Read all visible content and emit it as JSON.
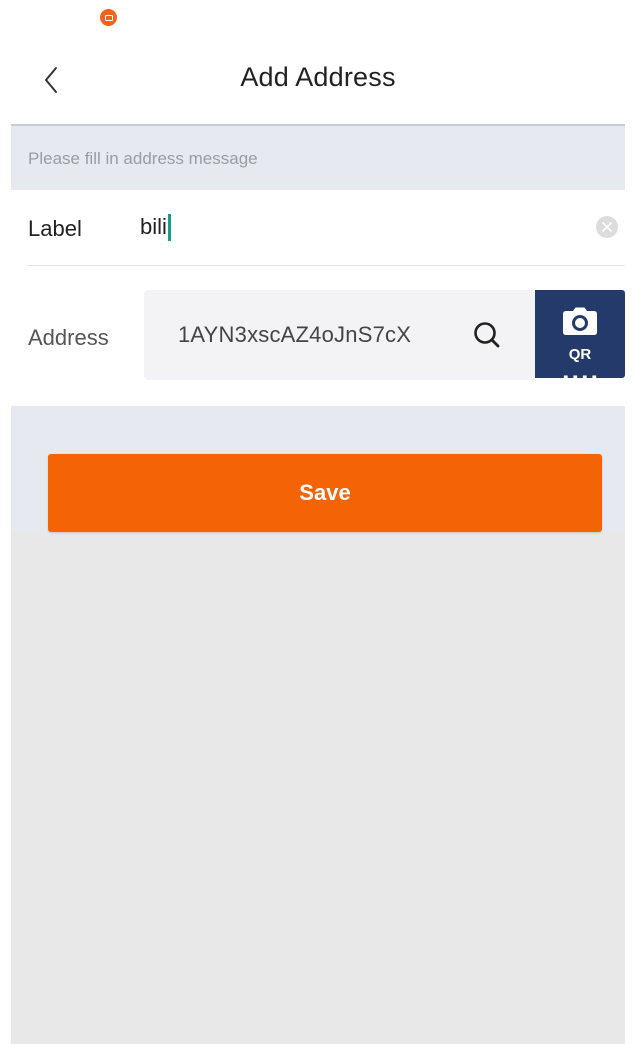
{
  "header": {
    "title": "Add Address",
    "back_icon": "chevron-left-icon"
  },
  "hint": "Please fill in address message",
  "form": {
    "label_field": {
      "label": "Label",
      "value": "bili",
      "clear_icon": "clear-circle-icon"
    },
    "address_field": {
      "label": "Address",
      "value": "1AYN3xscAZ4oJnS7cX",
      "search_icon": "search-icon"
    },
    "qr_button": {
      "icon": "camera-icon",
      "label": "QR"
    }
  },
  "save_button": {
    "label": "Save"
  },
  "colors": {
    "accent": "#f46305",
    "qr_button_bg": "#243a6b",
    "cursor": "#1a9a8c",
    "status_dot": "#f26419"
  }
}
